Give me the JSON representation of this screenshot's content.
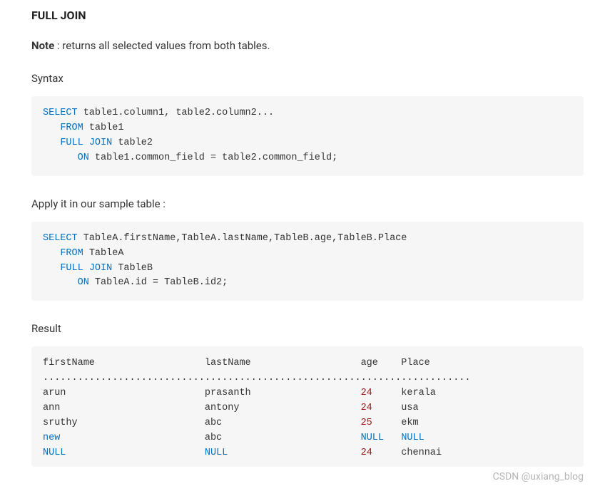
{
  "heading": "FULL JOIN",
  "note_bold": "Note",
  "note_text": " : returns all selected values from both tables.",
  "syntax_label": "Syntax",
  "apply_label": "Apply it in our sample table :",
  "result_label": "Result",
  "watermark": "CSDN @uxiang_blog",
  "sql1": {
    "select": "SELECT",
    "cols": " table1.column1, table2.column2...",
    "from": "FROM",
    "t1": " table1",
    "full": "FULL",
    "join": "JOIN",
    "t2": " table2",
    "on": "ON",
    "cond": " table1.common_field = table2.common_field;"
  },
  "sql2": {
    "select": "SELECT",
    "cols": " TableA.firstName,TableA.lastName,TableB.age,TableB.Place",
    "from": "FROM",
    "t1": " TableA",
    "full": "FULL",
    "join": "JOIN",
    "t2": " TableB",
    "on": "ON",
    "cond": " TableA.id = TableB.id2;"
  },
  "result": {
    "header": "firstName                   lastName                   age    Place",
    "divider": "..........................................................................",
    "row1_name": "arun                        prasanth                   ",
    "row1_age": "24",
    "row1_place": "     kerala",
    "row2_name": "ann                         antony                     ",
    "row2_age": "24",
    "row2_place": "     usa",
    "row3_name": "sruthy                      abc                        ",
    "row3_age": "25",
    "row3_place": "     ekm",
    "row4_name": "new",
    "row4_mid": "                         abc                        ",
    "row4_null1": "NULL",
    "row4_sp": "   ",
    "row4_null2": "NULL",
    "row5_null1": "NULL",
    "row5_mid": "                        ",
    "row5_null2": "NULL",
    "row5_sp": "                       ",
    "row5_age": "24",
    "row5_place": "     chennai"
  }
}
